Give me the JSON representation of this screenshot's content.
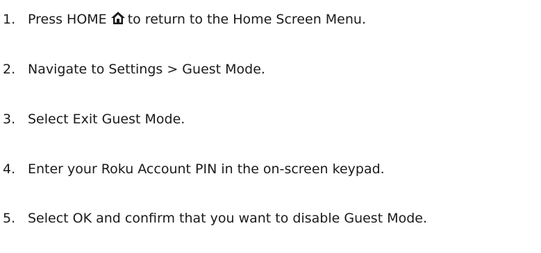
{
  "steps": [
    {
      "number": "1.",
      "text_before_icon": "Press HOME",
      "icon": "home-icon",
      "text_after_icon": "to return to the Home Screen Menu."
    },
    {
      "number": "2.",
      "text": "Navigate to Settings > Guest Mode."
    },
    {
      "number": "3.",
      "text": "Select Exit Guest Mode."
    },
    {
      "number": "4.",
      "text": "Enter your Roku Account PIN in the on-screen keypad."
    },
    {
      "number": "5.",
      "text": "Select OK and confirm that you want to disable Guest Mode."
    }
  ]
}
